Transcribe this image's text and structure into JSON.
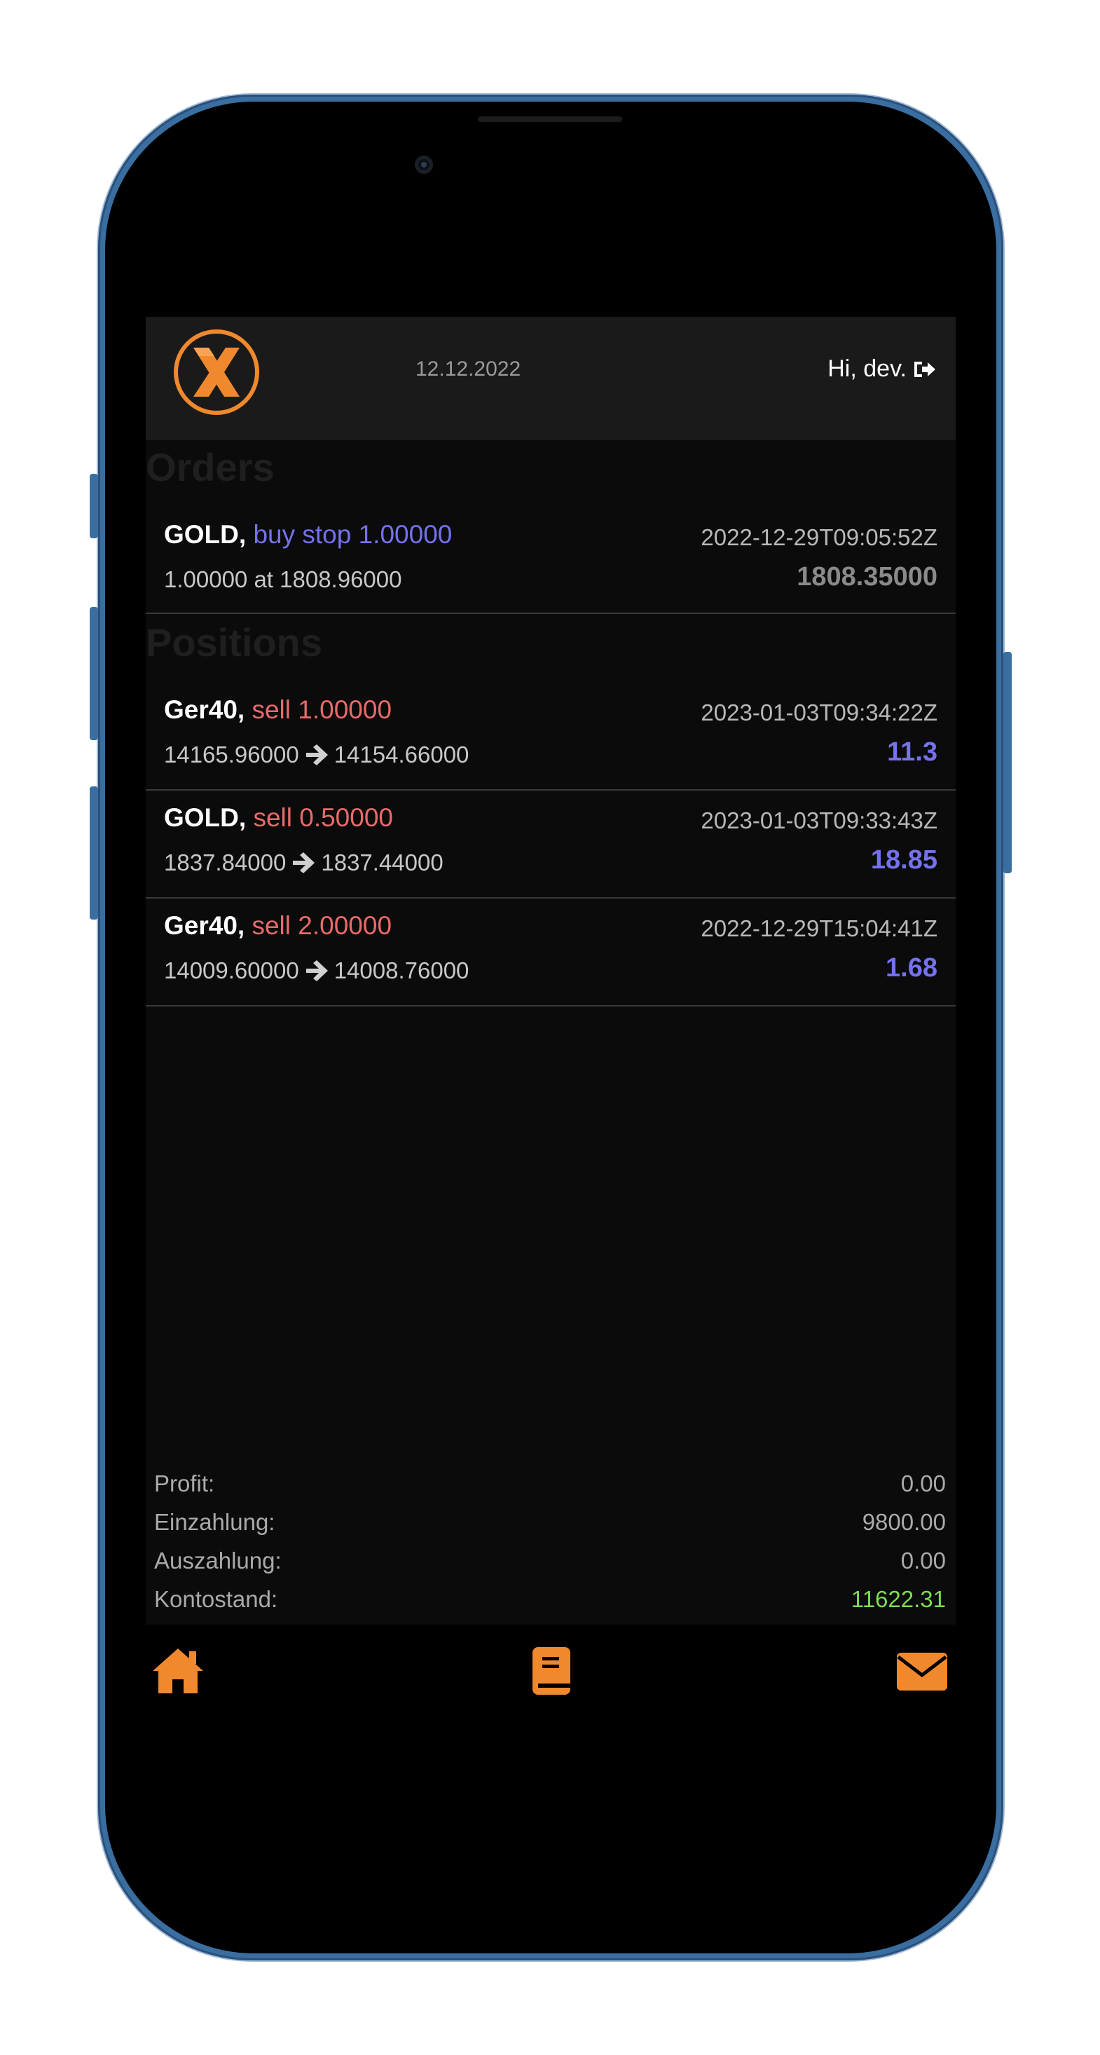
{
  "header": {
    "date": "12.12.2022",
    "greeting": "Hi, dev."
  },
  "orders": {
    "title": "Orders",
    "items": [
      {
        "symbol": "GOLD,",
        "action": "buy stop 1.00000",
        "time": "2022-12-29T09:05:52Z",
        "detail": "1.00000 at 1808.96000",
        "value": "1808.35000"
      }
    ]
  },
  "positions": {
    "title": "Positions",
    "items": [
      {
        "symbol": "Ger40,",
        "action": "sell 1.00000",
        "time": "2023-01-03T09:34:22Z",
        "from": "14165.96000",
        "to": "14154.66000",
        "value": "11.3"
      },
      {
        "symbol": "GOLD,",
        "action": "sell 0.50000",
        "time": "2023-01-03T09:33:43Z",
        "from": "1837.84000",
        "to": "1837.44000",
        "value": "18.85"
      },
      {
        "symbol": "Ger40,",
        "action": "sell 2.00000",
        "time": "2022-12-29T15:04:41Z",
        "from": "14009.60000",
        "to": "14008.76000",
        "value": "1.68"
      }
    ]
  },
  "summary": {
    "profit_label": "Profit:",
    "profit_value": "0.00",
    "deposit_label": "Einzahlung:",
    "deposit_value": "9800.00",
    "withdrawal_label": "Auszahlung:",
    "withdrawal_value": "0.00",
    "balance_label": "Kontostand:",
    "balance_value": "11622.31"
  },
  "nav": {
    "icons": [
      "home-icon",
      "book-icon",
      "envelope-icon"
    ]
  },
  "colors": {
    "accent": "#f0892e",
    "sell": "#ea6a6a",
    "buy": "#7472ee",
    "positive_value": "#7472ee",
    "order_value": "#8a8a8a",
    "balance": "#7ddc52"
  }
}
